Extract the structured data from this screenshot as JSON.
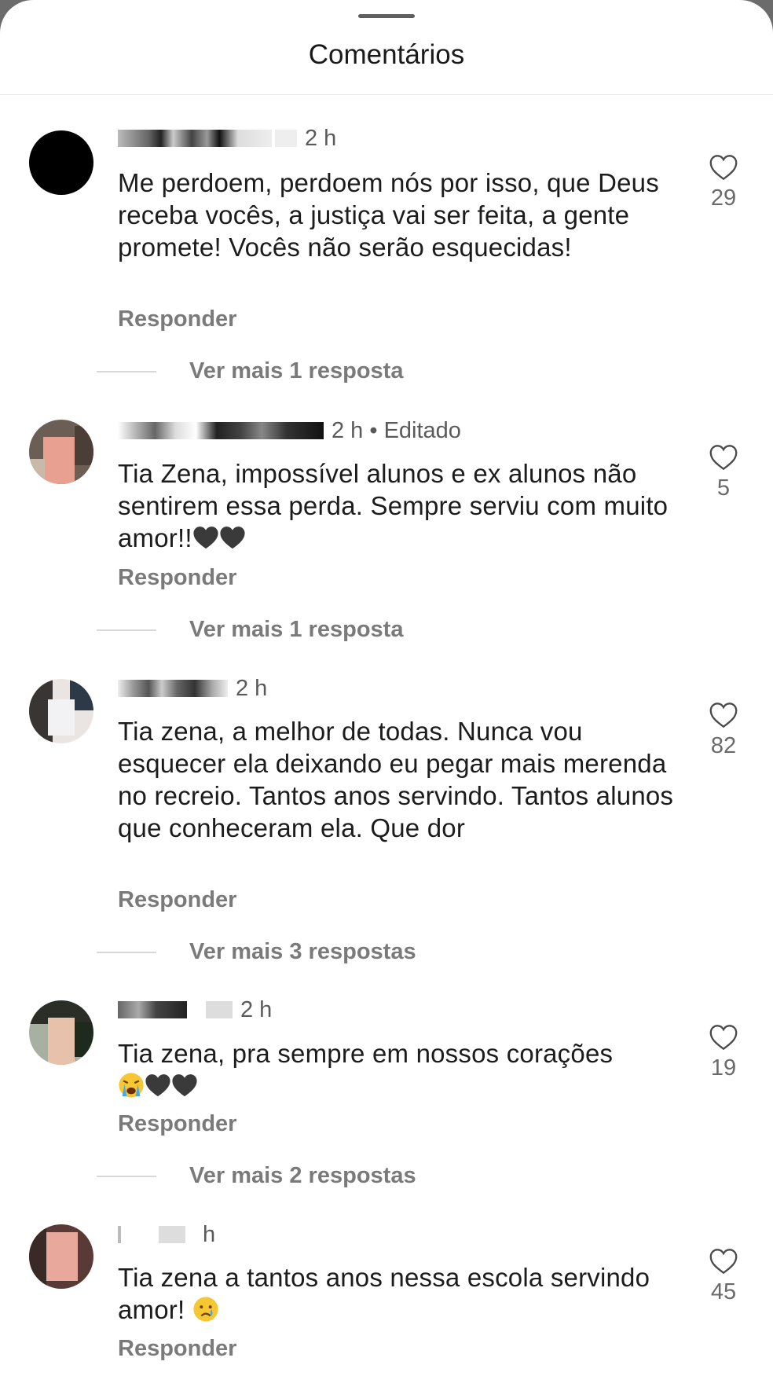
{
  "sheet": {
    "title": "Comentários"
  },
  "comments": [
    {
      "meta": "2 h",
      "text": "Me perdoem, perdoem nós por isso, que Deus receba vocês, a justiça vai ser feita, a gente promete! Vocês não serão esquecidas!",
      "reply_label": "Responder",
      "likes": "29",
      "more_replies": "Ver mais 1 resposta"
    },
    {
      "meta": "2 h • Editado",
      "text": "Tia Zena, impossível alunos e ex alunos não sentirem essa perda. Sempre serviu com muito amor!!",
      "emoji": [
        "black-heart",
        "black-heart"
      ],
      "reply_label": "Responder",
      "likes": "5",
      "more_replies": "Ver mais 1 resposta"
    },
    {
      "meta": "2 h",
      "text": "Tia zena, a melhor de todas. Nunca vou esquecer ela deixando eu pegar mais merenda no recreio. Tantos anos servindo. Tantos alunos que conheceram ela. Que dor",
      "reply_label": "Responder",
      "likes": "82",
      "more_replies": "Ver mais 3 respostas"
    },
    {
      "meta": "2 h",
      "text": "Tia zena, pra sempre em nossos corações",
      "emoji": [
        "loudly-crying-face",
        "black-heart",
        "black-heart"
      ],
      "reply_label": "Responder",
      "likes": "19",
      "more_replies": "Ver mais 2 respostas"
    },
    {
      "meta": "h",
      "text": "Tia zena a tantos anos nessa escola servindo amor!",
      "emoji": [
        "crying-face"
      ],
      "reply_label": "Responder",
      "likes": "45"
    }
  ],
  "colors": {
    "background": "#ffffff",
    "secondary_text": "#7a7a7a",
    "handle": "#5f5f5f"
  },
  "icons": {
    "like": "heart-outline-icon"
  }
}
